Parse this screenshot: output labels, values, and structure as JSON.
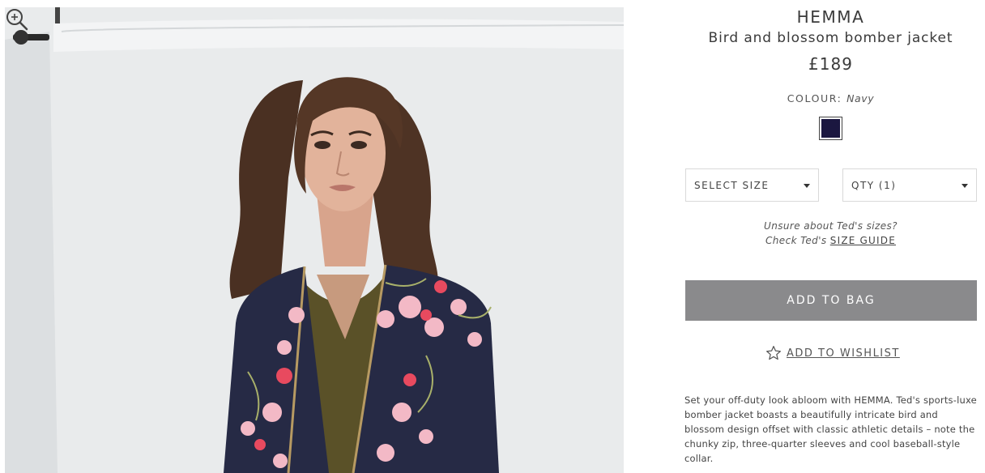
{
  "product": {
    "brand": "HEMMA",
    "name": "Bird and blossom bomber jacket",
    "price": "£189",
    "colour_label": "COLOUR:",
    "colour_value": "Navy",
    "swatch_color": "#1b1740",
    "size_select": "SELECT SIZE",
    "qty_select": "QTY (1)",
    "size_help_line1": "Unsure about Ted's sizes?",
    "size_help_line2_prefix": "Check Ted's",
    "size_guide_link": "SIZE GUIDE",
    "add_to_bag": "ADD TO BAG",
    "add_to_wishlist": "ADD TO WISHLIST",
    "description": "Set your off-duty look abloom with HEMMA. Ted's sports-luxe bomber jacket boasts a beautifully intricate bird and blossom design offset with classic athletic details – note the chunky zip, three-quarter sleeves and cool baseball-style collar."
  },
  "image": {
    "icons": [
      "zoom-in-icon",
      "star-outline-icon"
    ]
  },
  "colors": {
    "button_bg": "#8a8a8c",
    "text": "#3a3a3a",
    "jacket": "#262a45",
    "blossom": "#e84a5f"
  }
}
